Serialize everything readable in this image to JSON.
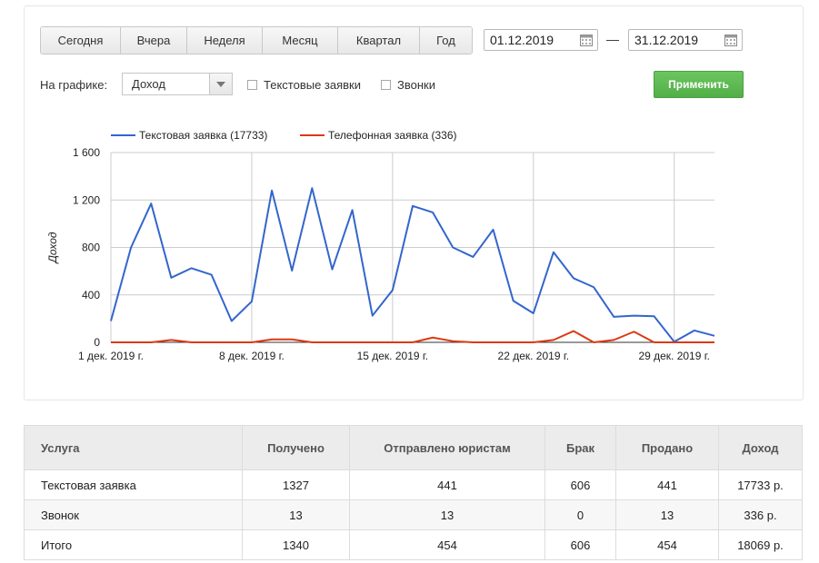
{
  "toolbar": {
    "periods": [
      "Сегодня",
      "Вчера",
      "Неделя",
      "Месяц",
      "Квартал",
      "Год"
    ],
    "date_from": "01.12.2019",
    "date_to": "31.12.2019",
    "date_separator": "—"
  },
  "filters": {
    "chart_label": "На графике:",
    "metric_selected": "Доход",
    "checkbox_text_requests": "Текстовые заявки",
    "checkbox_calls": "Звонки",
    "apply_label": "Применить"
  },
  "chart_data": {
    "type": "line",
    "ylabel": "Доход",
    "ylim": [
      0,
      1600
    ],
    "y_ticks": [
      "0",
      "400",
      "800",
      "1 200",
      "1 600"
    ],
    "y_tick_values": [
      0,
      400,
      800,
      1200,
      1600
    ],
    "x_tick_labels": [
      "1 дек. 2019 г.",
      "8 дек. 2019 г.",
      "15 дек. 2019 г.",
      "22 дек. 2019 г.",
      "29 дек. 2019 г."
    ],
    "x_tick_days": [
      1,
      8,
      15,
      22,
      29
    ],
    "x_days": [
      1,
      2,
      3,
      4,
      5,
      6,
      7,
      8,
      9,
      10,
      11,
      12,
      13,
      14,
      15,
      16,
      17,
      18,
      19,
      20,
      21,
      22,
      23,
      24,
      25,
      26,
      27,
      28,
      29,
      30,
      31
    ],
    "legend_position": "top-left",
    "grid": true,
    "series": [
      {
        "name": "Текстовая заявка (17733)",
        "color": "#3366cc",
        "values": [
          180,
          800,
          1170,
          545,
          625,
          570,
          180,
          345,
          1280,
          605,
          1300,
          615,
          1115,
          225,
          440,
          1150,
          1095,
          800,
          720,
          950,
          350,
          245,
          760,
          540,
          465,
          215,
          225,
          220,
          5,
          100,
          55
        ]
      },
      {
        "name": "Телефонная заявка (336)",
        "color": "#dc3912",
        "values": [
          0,
          0,
          0,
          20,
          0,
          0,
          0,
          0,
          25,
          25,
          0,
          0,
          0,
          0,
          0,
          0,
          40,
          10,
          0,
          0,
          0,
          0,
          20,
          95,
          0,
          20,
          90,
          0,
          0,
          0,
          0
        ]
      }
    ]
  },
  "table": {
    "headers": [
      "Услуга",
      "Получено",
      "Отправлено юристам",
      "Брак",
      "Продано",
      "Доход"
    ],
    "rows": [
      [
        "Текстовая заявка",
        "1327",
        "441",
        "606",
        "441",
        "17733 р."
      ],
      [
        "Звонок",
        "13",
        "13",
        "0",
        "13",
        "336 р."
      ],
      [
        "Итого",
        "1340",
        "454",
        "606",
        "454",
        "18069 р."
      ]
    ]
  }
}
